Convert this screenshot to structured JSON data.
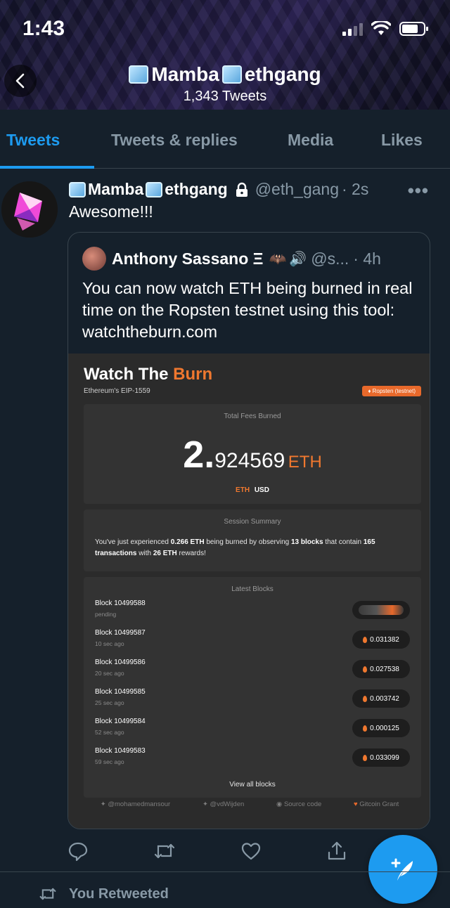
{
  "status_bar": {
    "time": "1:43"
  },
  "profile": {
    "name_a": "Mamba",
    "name_b": "ethgang",
    "tweet_count": "1,343 Tweets"
  },
  "tabs": [
    {
      "label": "Tweets",
      "active": true
    },
    {
      "label": "Tweets & replies",
      "active": false
    },
    {
      "label": "Media",
      "active": false
    },
    {
      "label": "Likes",
      "active": false
    }
  ],
  "tweet": {
    "name_a": "Mamba",
    "name_b": "ethgang",
    "handle": "@eth_gang",
    "time": "· 2s",
    "more": "•••",
    "text": "Awesome!!!",
    "quote": {
      "name": "Anthony Sassano Ξ",
      "handle": "@s...",
      "time": "· 4h",
      "text": "You can now watch ETH being burned in real time on the Ropsten testnet using this tool: watchtheburn.com",
      "image": {
        "title_a": "Watch The",
        "title_b": "Burn",
        "subtitle": "Ethereum's EIP-1559",
        "network_badge": "♦ Ropsten (testnet)",
        "total_fees_label": "Total Fees Burned",
        "fees_int": "2.",
        "fees_dec": "924569",
        "fees_unit": "ETH",
        "currency_eth": "ETH",
        "currency_usd": "USD",
        "session_label": "Session Summary",
        "summary": {
          "p1": "You've just experienced ",
          "b1": "0.266 ETH",
          "p2": " being burned by observing ",
          "b2": "13 blocks",
          "p3": " that contain ",
          "b3": "165 transactions",
          "p4": " with ",
          "b4": "26 ETH",
          "p5": " rewards!"
        },
        "latest_label": "Latest Blocks",
        "blocks": [
          {
            "name": "Block 10499588",
            "time": "pending",
            "burned": ""
          },
          {
            "name": "Block 10499587",
            "time": "10 sec ago",
            "burned": "0.031382"
          },
          {
            "name": "Block 10499586",
            "time": "20 sec ago",
            "burned": "0.027538"
          },
          {
            "name": "Block 10499585",
            "time": "25 sec ago",
            "burned": "0.003742"
          },
          {
            "name": "Block 10499584",
            "time": "52 sec ago",
            "burned": "0.000125"
          },
          {
            "name": "Block 10499583",
            "time": "59 sec ago",
            "burned": "0.033099"
          }
        ],
        "view_all": "View all blocks",
        "footer": {
          "link1": "@mohamedmansour",
          "link2": "@vdWijden",
          "link3": "Source code",
          "link4": "Gitcoin Grant"
        }
      }
    }
  },
  "retweeted_label": "You Retweeted",
  "colors": {
    "accent": "#1d9bf0",
    "burn_orange": "#f0782f",
    "background": "#15202b"
  }
}
